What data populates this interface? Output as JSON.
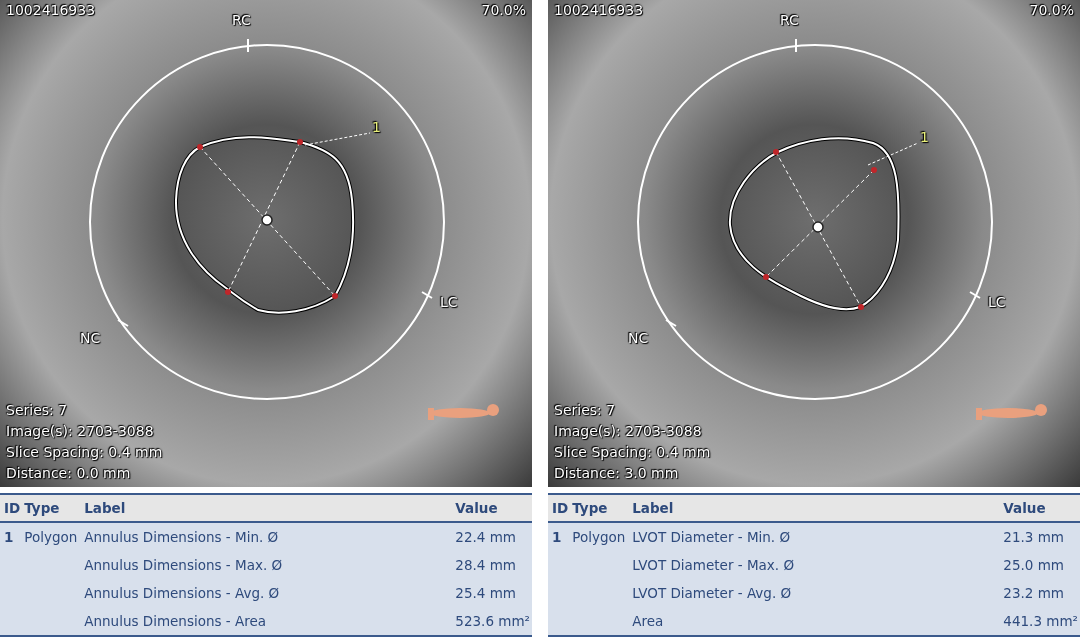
{
  "panels": [
    {
      "patient_id": "1002416933",
      "zoom": "70.0%",
      "orientation_labels": [
        {
          "kind": "top",
          "text": "RC"
        },
        {
          "kind": "right",
          "text": "LC"
        },
        {
          "kind": "left",
          "text": "NC"
        }
      ],
      "measurement_id": "1",
      "info_lines": [
        "Series: 7",
        "Image(s): 2703-3088",
        "Slice Spacing: 0.4 mm",
        "Distance: 0.0 mm"
      ],
      "table": {
        "columns": [
          "ID",
          "Type",
          "Label",
          "Value"
        ],
        "rows": [
          {
            "id": "1",
            "type": "Polygon",
            "label": "Annulus Dimensions - Min. Ø",
            "value": "22.4 mm"
          },
          {
            "id": "",
            "type": "",
            "label": "Annulus Dimensions - Max. Ø",
            "value": "28.4 mm"
          },
          {
            "id": "",
            "type": "",
            "label": "Annulus Dimensions - Avg. Ø",
            "value": "25.4 mm"
          },
          {
            "id": "",
            "type": "",
            "label": "Annulus Dimensions - Area",
            "value": "523.6 mm²"
          }
        ]
      }
    },
    {
      "patient_id": "1002416933",
      "zoom": "70.0%",
      "orientation_labels": [
        {
          "kind": "top",
          "text": "RC"
        },
        {
          "kind": "right",
          "text": "LC"
        },
        {
          "kind": "left",
          "text": "NC"
        }
      ],
      "measurement_id": "1",
      "info_lines": [
        "Series: 7",
        "Image(s): 2703-3088",
        "Slice Spacing: 0.4 mm",
        "Distance: 3.0 mm"
      ],
      "table": {
        "columns": [
          "ID",
          "Type",
          "Label",
          "Value"
        ],
        "rows": [
          {
            "id": "1",
            "type": "Polygon",
            "label": "LVOT Diameter - Min. Ø",
            "value": "21.3 mm"
          },
          {
            "id": "",
            "type": "",
            "label": "LVOT Diameter - Max. Ø",
            "value": "25.0 mm"
          },
          {
            "id": "",
            "type": "",
            "label": "LVOT Diameter - Avg. Ø",
            "value": "23.2 mm"
          },
          {
            "id": "",
            "type": "",
            "label": "Area",
            "value": "441.3 mm²"
          }
        ]
      }
    }
  ]
}
